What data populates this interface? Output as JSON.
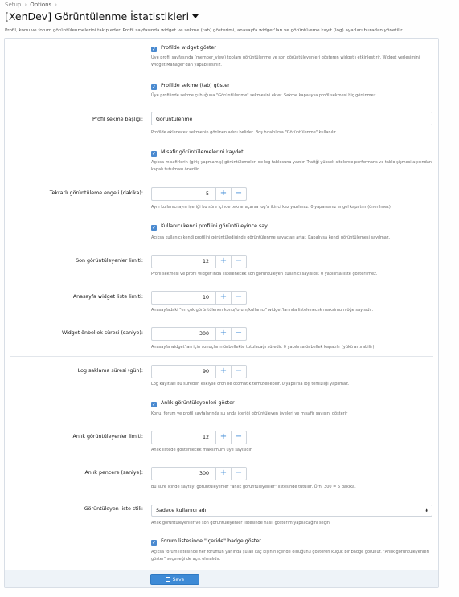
{
  "breadcrumb": {
    "items": [
      "Setup",
      "Options"
    ]
  },
  "page": {
    "title": "[XenDev] Görüntülenme İstatistikleri",
    "description": "Profil, konu ve forum görüntülenmelerini takip eder. Profil sayfasında widget ve sekme (tab) gösterimi, anasayfa widget'ları ve görüntüleme kayıt (log) ayarları buradan yönetilir."
  },
  "options": {
    "profile_widget": {
      "label": "Profilde widget göster",
      "checked": true,
      "hint": "Üye profil sayfasında (member_view) toplam görüntülenme ve son görüntüleyenleri gösteren widget'ı etkinleştirir. Widget yerleşimini Widget Manager'dan yapabilirsiniz."
    },
    "profile_tab": {
      "label": "Profilde sekme (tab) göster",
      "checked": true,
      "hint": "Üye profilinde sekme çubuğuna \"Görüntülenme\" sekmesini ekler. Sekme kapalıysa profil sekmesi hiç görünmez."
    },
    "tab_title": {
      "label": "Profil sekme başlığı:",
      "value": "Görüntülenme",
      "hint": "Profilde eklenecek sekmenin görünen adını belirler. Boş bırakılırsa \"Görüntülenme\" kullanılır."
    },
    "log_guest": {
      "label": "Misafir görüntülemelerini kaydet",
      "checked": true,
      "hint": "Açıksa misafirlerin (giriş yapmamış) görüntülemeleri de log tablosuna yazılır. Trafiği yüksek sitelerde performans ve tablo şişmesi açısından kapalı tutulması önerilir."
    },
    "repeat_block": {
      "label": "Tekrarlı görüntüleme engeli (dakika):",
      "value": "5",
      "hint": "Aynı kullanıcı aynı içeriği bu süre içinde tekrar açarsa log'a ikinci kez yazılmaz. 0 yaparsanız engel kapatılır (önerilmez)."
    },
    "count_self": {
      "label": "Kullanıcı kendi profilini görüntüleyince say",
      "checked": true,
      "hint": "Açıksa kullanıcı kendi profilini görüntülediğinde görüntülenme sayaçları artar. Kapalıysa kendi görüntülemesi sayılmaz."
    },
    "recent_limit": {
      "label": "Son görüntüleyenler limiti:",
      "value": "12",
      "hint": "Profil sekmesi ve profil widget'ında listelenecek son görüntüleyen kullanıcı sayısıdır. 0 yapılırsa liste gösterilmez."
    },
    "home_widget_limit": {
      "label": "Anasayfa widget liste limiti:",
      "value": "10",
      "hint": "Anasayfadaki \"en çok görüntülenen konu/forum/kullanıcı\" widget'larında listelenecek maksimum öğe sayısıdır."
    },
    "widget_cache": {
      "label": "Widget önbellek süresi (saniye):",
      "value": "300",
      "hint": "Anasayfa widget'ları için sonuçların önbellekte tutulacağı süredir. 0 yapılırsa önbellek kapatılır (yükü artırabilir)."
    },
    "log_retention": {
      "label": "Log saklama süresi (gün):",
      "value": "90",
      "hint": "Log kayıtları bu süreden eskiyse cron ile otomatik temizlenebilir. 0 yapılırsa log temizliği yapılmaz."
    },
    "live_viewers": {
      "label": "Anlık görüntüleyenleri göster",
      "checked": true,
      "hint": "Konu, forum ve profil sayfalarında şu anda içeriği görüntüleyen üyeleri ve misafir sayısını gösterir"
    },
    "live_limit": {
      "label": "Anlık görüntüleyenler limiti:",
      "value": "12",
      "hint": "Anlık listede gösterilecek maksimum üye sayısıdır."
    },
    "live_window": {
      "label": "Anlık pencere (saniye):",
      "value": "300",
      "hint": "Bu süre içinde sayfayı görüntüleyenler \"anlık görüntüleyenler\" listesinde tutulur. Örn: 300 = 5 dakika."
    },
    "viewer_style": {
      "label": "Görüntüleyen liste stili:",
      "value": "Sadece kullanıcı adı",
      "hint": "Anlık görüntüleyenler ve son görüntüleyenler listesinde nasıl gösterim yapılacağını seçin."
    },
    "forum_badge": {
      "label": "Forum listesinde \"içeride\" badge göster",
      "checked": true,
      "hint": "Açıksa forum listesinde her forumun yanında şu an kaç kişinin içeride olduğunu gösteren küçük bir badge görünür. \"Anlık görüntüleyenleri göster\" seçeneği de açık olmalıdır."
    }
  },
  "stepper": {
    "plus": "+",
    "minus": "−"
  },
  "footer": {
    "save_label": "Save"
  },
  "icons": {
    "caret": "chevron-down-icon",
    "check": "check-icon",
    "select": "select-arrow-icon",
    "save": "save-icon"
  },
  "colors": {
    "accent": "#3d8ad6",
    "border": "#d8dee6",
    "footer_bg": "#eef3f8"
  }
}
